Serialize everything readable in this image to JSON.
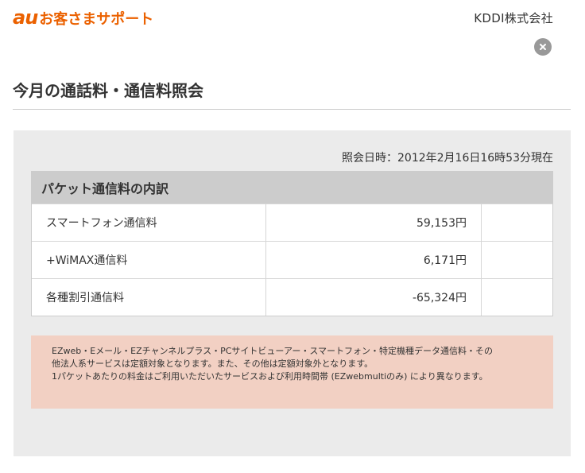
{
  "header": {
    "brand_au": "au",
    "brand_text": "お客さまサポート",
    "company": "KDDI株式会社",
    "close_icon": "close-icon"
  },
  "page": {
    "title": "今月の通話料・通信料照会"
  },
  "panel": {
    "timestamp": "照会日時：2012年2月16日16時53分現在",
    "breakdown": {
      "title": "パケット通信料の内訳",
      "rows": [
        {
          "label": "スマートフォン通信料",
          "amount": "59,153円"
        },
        {
          "label": "+WiMAX通信料",
          "amount": "6,171円"
        },
        {
          "label": "各種割引通信料",
          "amount": "-65,324円"
        }
      ]
    },
    "notice": {
      "lines": [
        "EZweb・Eメール・EZチャンネルプラス・PCサイトビューアー・スマートフォン・特定機種データ通信料・その",
        "他法人系サービスは定額対象となります。また、その他は定額対象外となります。",
        "1パケットあたりの料金はご利用いただいたサービスおよび利用時間帯 (EZwebmultiのみ) により異なります。"
      ]
    }
  },
  "colors": {
    "brand": "#eb6100",
    "panel_bg": "#ebebeb",
    "table_header_bg": "#cccccc",
    "notice_bg": "#f2d0c3"
  }
}
